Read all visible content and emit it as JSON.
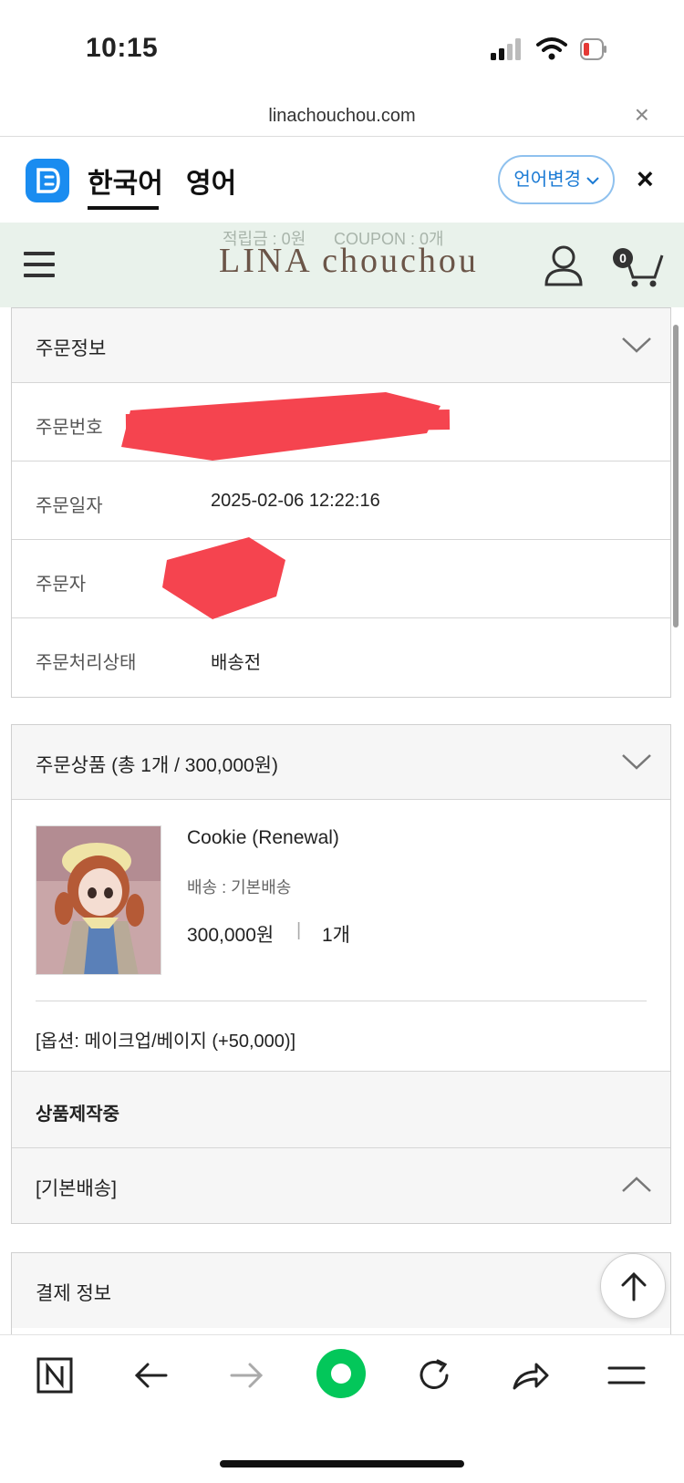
{
  "status_bar": {
    "time": "10:15"
  },
  "url_bar": {
    "url": "linachouchou.com",
    "close": "×"
  },
  "translate_bar": {
    "tabs": [
      "한국어",
      "영어"
    ],
    "change_language": "언어변경",
    "close": "×"
  },
  "site_header": {
    "points": "적립금 : 0원",
    "coupon": "COUPON : 0개",
    "brand": "LINA chouchou",
    "cart_count": "0"
  },
  "order_info": {
    "title": "주문정보",
    "rows": [
      {
        "label": "주문번호",
        "value": ""
      },
      {
        "label": "주문일자",
        "value": "2025-02-06 12:22:16"
      },
      {
        "label": "주문자",
        "value": ""
      },
      {
        "label": "주문처리상태",
        "value": "배송전"
      }
    ]
  },
  "order_items": {
    "title": "주문상품 (총 1개 / 300,000원)",
    "product": {
      "name": "Cookie (Renewal)",
      "shipping": "배송 : 기본배송",
      "price": "300,000원",
      "separator": "|",
      "quantity": "1개",
      "option": "[옵션: 메이크업/베이지 (+50,000)]"
    },
    "status": "상품제작중",
    "shipping_group": "[기본배송]"
  },
  "payment": {
    "title": "결제 정보"
  },
  "colors": {
    "header_bg": "#e9f2eb",
    "brand": "#6b5548",
    "accent_blue": "#1a7ad4",
    "naver_green": "#03c75a",
    "redaction": "#f5444f"
  },
  "icons": [
    "signal-icon",
    "wifi-icon",
    "battery-icon",
    "translate-logo-icon",
    "hamburger-icon",
    "user-icon",
    "cart-icon",
    "chevron-down-icon",
    "chevron-up-icon",
    "arrow-up-icon",
    "naver-n-icon",
    "back-arrow-icon",
    "forward-arrow-icon",
    "naver-green-button-icon",
    "refresh-icon",
    "share-icon",
    "menu-icon"
  ]
}
